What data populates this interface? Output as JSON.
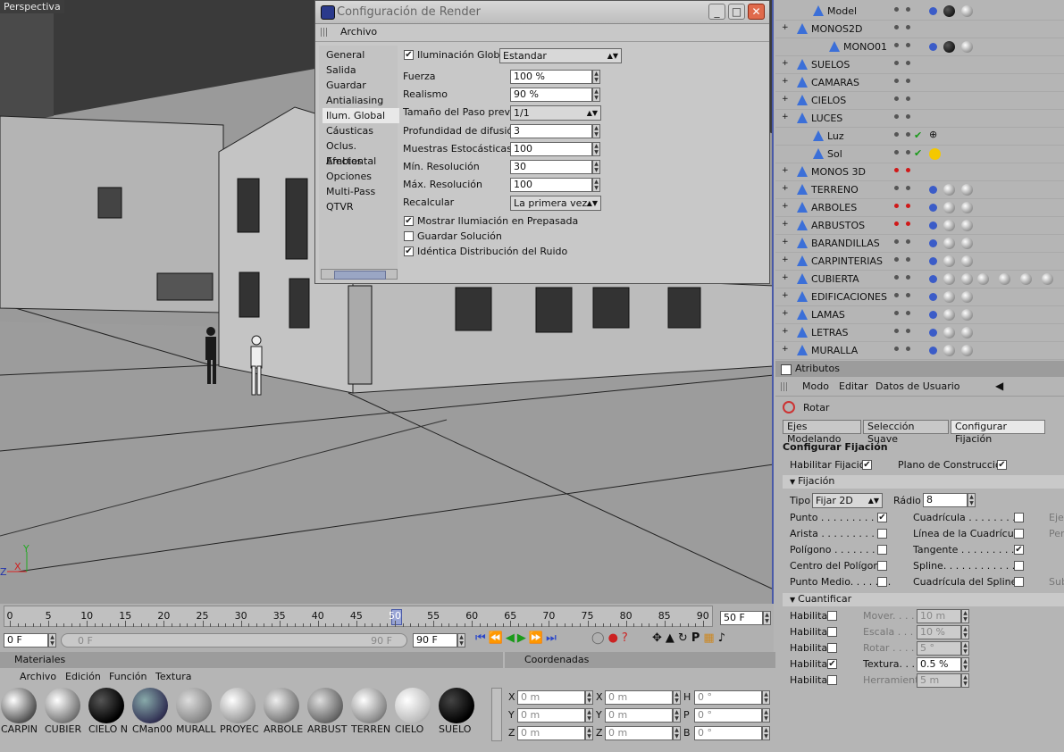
{
  "viewport": {
    "label": "Perspectiva",
    "axes": {
      "x": "X",
      "y": "Y",
      "z": "Z"
    }
  },
  "render_dialog": {
    "title": "Configuración de Render",
    "menu": [
      "Archivo"
    ],
    "sidebar": [
      "General",
      "Salida",
      "Guardar",
      "Antialiasing",
      "Ilum. Global",
      "Cáusticas",
      "Oclus. Ambiental",
      "Efectos",
      "Opciones",
      "Multi-Pass",
      "QTVR"
    ],
    "selected": "Ilum. Global",
    "gi_label": "Iluminación Global",
    "gi_mode": "Estandar",
    "fields": [
      {
        "label": "Fuerza",
        "value": "100 %"
      },
      {
        "label": "Realismo",
        "value": "90 %"
      },
      {
        "label": "Tamaño del Paso previo",
        "value": "1/1",
        "combo": true
      },
      {
        "label": "Profundidad de difusión",
        "value": "3"
      },
      {
        "label": "Muestras Estocásticas",
        "value": "100"
      },
      {
        "label": "Mín. Resolución",
        "value": "30"
      },
      {
        "label": "Máx. Resolución",
        "value": "100"
      },
      {
        "label": "Recalcular",
        "value": "La primera vez",
        "combo": true
      }
    ],
    "checks": [
      {
        "label": "Mostrar Ilumiación en Prepasada",
        "checked": true
      },
      {
        "label": "Guardar Solución",
        "checked": false
      },
      {
        "label": "Idéntica Distribución del Ruido",
        "checked": true
      }
    ]
  },
  "objects": [
    {
      "name": "Model",
      "indent": 1,
      "tags": "bk"
    },
    {
      "name": "MONOS2D",
      "indent": 0,
      "tags": ""
    },
    {
      "name": "MONO01",
      "indent": 2,
      "tags": "bk"
    },
    {
      "name": "SUELOS",
      "indent": 0,
      "tags": ""
    },
    {
      "name": "CAMARAS",
      "indent": 0,
      "tags": ""
    },
    {
      "name": "CIELOS",
      "indent": 0,
      "tags": ""
    },
    {
      "name": "LUCES",
      "indent": 0,
      "tags": ""
    },
    {
      "name": "Luz",
      "indent": 1,
      "tags": "light"
    },
    {
      "name": "Sol",
      "indent": 1,
      "tags": "sun"
    },
    {
      "name": "MONOS 3D",
      "indent": 0,
      "tags": "",
      "red": true
    },
    {
      "name": "TERRENO",
      "indent": 0,
      "tags": "gr"
    },
    {
      "name": "ARBOLES",
      "indent": 0,
      "tags": "gr",
      "red": true
    },
    {
      "name": "ARBUSTOS",
      "indent": 0,
      "tags": "gr",
      "red": true
    },
    {
      "name": "BARANDILLAS",
      "indent": 0,
      "tags": "gr"
    },
    {
      "name": "CARPINTERIAS",
      "indent": 0,
      "tags": "gr"
    },
    {
      "name": "CUBIERTA",
      "indent": 0,
      "tags": "many"
    },
    {
      "name": "EDIFICACIONES",
      "indent": 0,
      "tags": "gr"
    },
    {
      "name": "LAMAS",
      "indent": 0,
      "tags": "gr"
    },
    {
      "name": "LETRAS",
      "indent": 0,
      "tags": "gr"
    },
    {
      "name": "MURALLA",
      "indent": 0,
      "tags": "gr"
    }
  ],
  "attributes": {
    "title": "Atributos",
    "menu": [
      "Modo",
      "Editar",
      "Datos de Usuario"
    ],
    "tool": "Rotar",
    "tabs": [
      "Ejes Modelando",
      "Selección Suave",
      "Configurar Fijación"
    ],
    "section": "Configurar Fijación",
    "enable_snap": "Habilitar Fijación",
    "plane": "Plano de Construcción",
    "group1": "Fijación",
    "tipo_label": "Tipo",
    "tipo": "Fijar 2D",
    "radio_label": "Rádio",
    "radio": "8",
    "left_opts": [
      {
        "label": "Punto . . . . . . . . . . .",
        "checked": true
      },
      {
        "label": "Arista . . . . . . . . . . .",
        "checked": false
      },
      {
        "label": "Polígono . . . . . . . . .",
        "checked": false
      },
      {
        "label": "Centro del Polígono",
        "checked": false
      },
      {
        "label": "Punto Medio. . . . . . .",
        "checked": false
      }
    ],
    "right_opts": [
      {
        "label": "Cuadrícula . . . . . . . . .",
        "checked": false
      },
      {
        "label": "Línea de la Cuadrícula",
        "checked": false
      },
      {
        "label": "Tangente . . . . . . . . . .",
        "checked": true
      },
      {
        "label": "Spline. . . . . . . . . . . . .",
        "checked": false
      },
      {
        "label": "Cuadrícula del Spline",
        "checked": false
      }
    ],
    "far_right": [
      "Eje",
      "Per",
      "",
      "",
      "Sub"
    ],
    "group2": "Cuantificar",
    "quant": [
      {
        "en": "Habilitar",
        "checked": false,
        "label": "Mover. . . . .",
        "value": "10 m",
        "active": false
      },
      {
        "en": "Habilitar",
        "checked": false,
        "label": "Escala . . . .",
        "value": "10 %",
        "active": false
      },
      {
        "en": "Habilitar",
        "checked": false,
        "label": "Rotar . . . . .",
        "value": "5 °",
        "active": false
      },
      {
        "en": "Habilitar",
        "checked": true,
        "label": "Textura. . . .",
        "value": "0.5 %",
        "active": true
      },
      {
        "en": "Habilitar",
        "checked": false,
        "label": "Herramienta",
        "value": "5 m",
        "active": false
      }
    ]
  },
  "timeline": {
    "ticks": [
      "0",
      "5",
      "10",
      "15",
      "20",
      "25",
      "30",
      "35",
      "40",
      "45",
      "50",
      "55",
      "60",
      "65",
      "70",
      "75",
      "80",
      "85",
      "90"
    ],
    "current": "50",
    "frame_end": "50 F",
    "start": "0 F",
    "range_start": "0 F",
    "range_end": "90 F",
    "end": "90 F"
  },
  "materials": {
    "title": "Materiales",
    "menu": [
      "Archivo",
      "Edición",
      "Función",
      "Textura"
    ],
    "items": [
      "CARPIN",
      "CUBIER",
      "CIELO N",
      "CMan00",
      "MURALL",
      "PROYEC",
      "ARBOLE",
      "ARBUST",
      "TERREN",
      "CIELO",
      "SUELO"
    ]
  },
  "coords": {
    "title": "Coordenadas",
    "rows": [
      {
        "a": "X",
        "av": "0 m",
        "b": "X",
        "bv": "0 m",
        "c": "H",
        "cv": "0 °"
      },
      {
        "a": "Y",
        "av": "0 m",
        "b": "Y",
        "bv": "0 m",
        "c": "P",
        "cv": "0 °"
      },
      {
        "a": "Z",
        "av": "0 m",
        "b": "Z",
        "bv": "0 m",
        "c": "B",
        "cv": "0 °"
      }
    ]
  }
}
